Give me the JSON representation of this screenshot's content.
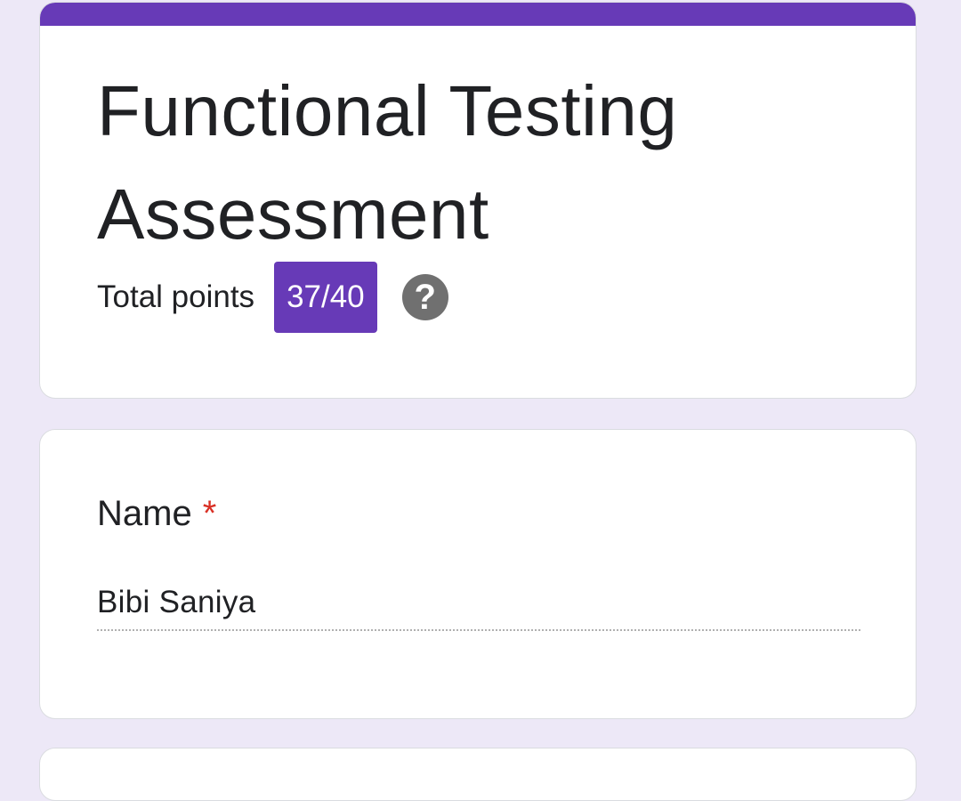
{
  "header": {
    "title": "Functional Testing Assessment",
    "total_points_label": "Total points",
    "score": "37/40",
    "help_glyph": "?"
  },
  "question": {
    "title": "Name",
    "required_marker": "*",
    "answer": "Bibi Saniya"
  },
  "colors": {
    "accent": "#673ab7",
    "background": "#ede8f7",
    "required": "#d93025",
    "help_icon": "#707070"
  },
  "icons": {
    "help": "help-circle-icon"
  }
}
